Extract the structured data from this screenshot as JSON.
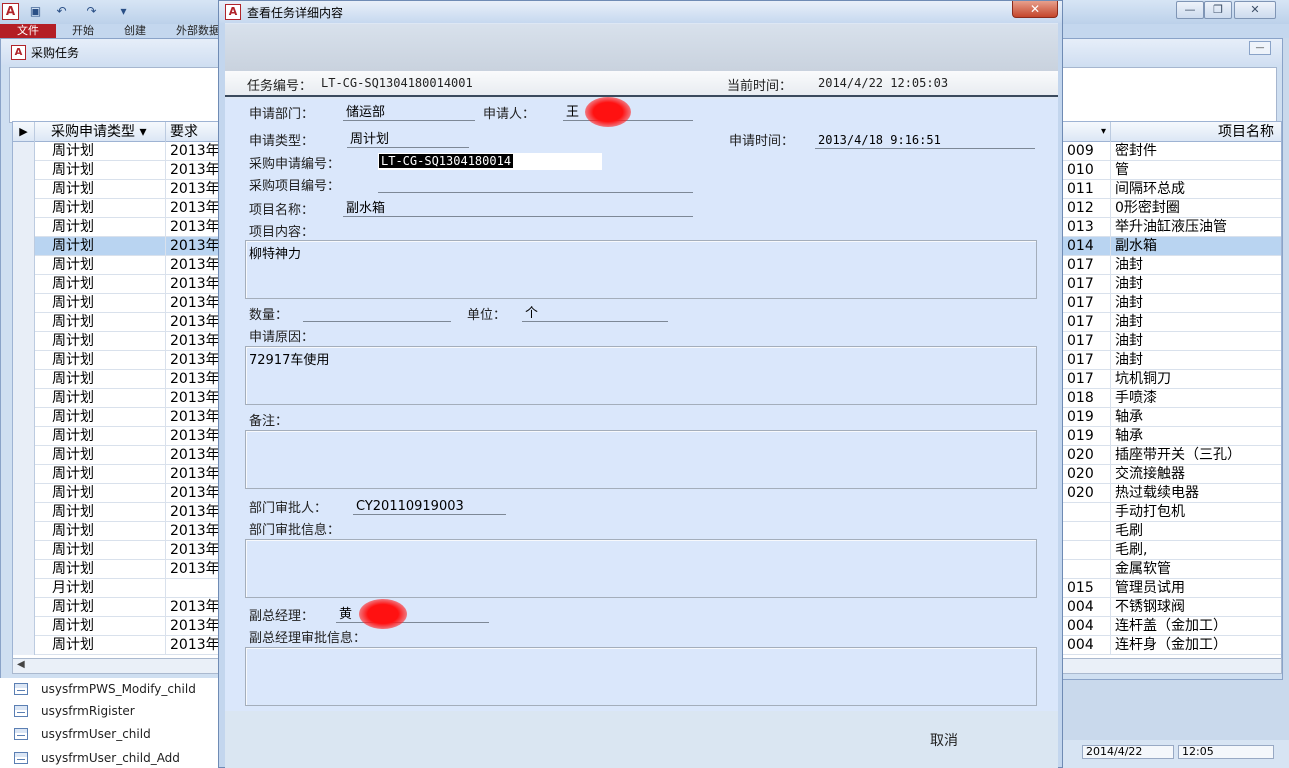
{
  "app": {
    "icon_letter": "A",
    "ribbon_tabs": [
      "文件",
      "开始",
      "创建",
      "外部数据"
    ],
    "quick_access": [
      "save-icon",
      "undo-icon",
      "redo-icon",
      "customize-icon"
    ],
    "window_controls": [
      "minimize",
      "restore",
      "close"
    ]
  },
  "inner_window": {
    "title": "采购任务",
    "columns": [
      "采购申请类型",
      "要求",
      "项目名称"
    ],
    "rows": [
      {
        "type": "周计划",
        "date": "2013年",
        "code": "009",
        "name": "密封件"
      },
      {
        "type": "周计划",
        "date": "2013年",
        "code": "010",
        "name": "管"
      },
      {
        "type": "周计划",
        "date": "2013年",
        "code": "011",
        "name": "间隔环总成"
      },
      {
        "type": "周计划",
        "date": "2013年",
        "code": "012",
        "name": "0形密封圈"
      },
      {
        "type": "周计划",
        "date": "2013年",
        "code": "013",
        "name": "举升油缸液压油管"
      },
      {
        "type": "周计划",
        "date": "2013年",
        "code": "014",
        "name": "副水箱"
      },
      {
        "type": "周计划",
        "date": "2013年",
        "code": "017",
        "name": "油封"
      },
      {
        "type": "周计划",
        "date": "2013年",
        "code": "017",
        "name": "油封"
      },
      {
        "type": "周计划",
        "date": "2013年",
        "code": "017",
        "name": "油封"
      },
      {
        "type": "周计划",
        "date": "2013年",
        "code": "017",
        "name": "油封"
      },
      {
        "type": "周计划",
        "date": "2013年",
        "code": "017",
        "name": "油封"
      },
      {
        "type": "周计划",
        "date": "2013年",
        "code": "017",
        "name": "油封"
      },
      {
        "type": "周计划",
        "date": "2013年",
        "code": "017",
        "name": "坑机铜刀"
      },
      {
        "type": "周计划",
        "date": "2013年",
        "code": "018",
        "name": "手喷漆"
      },
      {
        "type": "周计划",
        "date": "2013年",
        "code": "019",
        "name": "轴承"
      },
      {
        "type": "周计划",
        "date": "2013年",
        "code": "019",
        "name": "轴承"
      },
      {
        "type": "周计划",
        "date": "2013年",
        "code": "020",
        "name": "插座带开关（三孔）"
      },
      {
        "type": "周计划",
        "date": "2013年",
        "code": "020",
        "name": "交流接触器"
      },
      {
        "type": "周计划",
        "date": "2013年",
        "code": "020",
        "name": "热过载续电器"
      },
      {
        "type": "周计划",
        "date": "2013年",
        "code": "",
        "name": "手动打包机"
      },
      {
        "type": "周计划",
        "date": "2013年",
        "code": "",
        "name": "毛刷"
      },
      {
        "type": "周计划",
        "date": "2013年",
        "code": "",
        "name": "毛刷,"
      },
      {
        "type": "周计划",
        "date": "2013年",
        "code": "",
        "name": "金属软管"
      },
      {
        "type": "月计划",
        "date": "",
        "code": "015",
        "name": "管理员试用"
      },
      {
        "type": "周计划",
        "date": "2013年",
        "code": "004",
        "name": "不锈钢球阀"
      },
      {
        "type": "周计划",
        "date": "2013年",
        "code": "004",
        "name": "连杆盖（金加工）"
      },
      {
        "type": "周计划",
        "date": "2013年",
        "code": "004",
        "name": "连杆身（金加工）"
      }
    ]
  },
  "nav": {
    "items": [
      "usysfrmPWS_Modify_child",
      "usysfrmRigister",
      "usysfrmUser_child",
      "usysfrmUser_child_Add"
    ]
  },
  "status": {
    "date": "2014/4/22",
    "time": "12:05"
  },
  "dialog": {
    "icon_letter": "A",
    "title": "查看任务详细内容",
    "close_glyph": "✕",
    "task_no_label": "任务编号：",
    "task_no": "LT-CG-SQ1304180014001",
    "current_time_label": "当前时间：",
    "current_time": "2014/4/22 12:05:03",
    "fields": {
      "dept_label": "申请部门：",
      "dept": "储运部",
      "applicant_label": "申请人：",
      "applicant": "王",
      "type_label": "申请类型：",
      "type": "周计划",
      "apply_time_label": "申请时间：",
      "apply_time": "2013/4/18 9:16:51",
      "apply_no_label": "采购申请编号：",
      "apply_no": "LT-CG-SQ1304180014",
      "project_no_label": "采购项目编号：",
      "project_no": "",
      "project_name_label": "项目名称：",
      "project_name": "副水箱",
      "content_label": "项目内容：",
      "content": "柳特神力",
      "qty_label": "数量：",
      "qty": "",
      "unit_label": "单位：",
      "unit": "个",
      "reason_label": "申请原因：",
      "reason": "72917车使用",
      "remark_label": "备注：",
      "remark": "",
      "dept_approver_label": "部门审批人：",
      "dept_approver": "CY20110919003",
      "dept_info_label": "部门审批信息：",
      "dept_info": "",
      "vgm_label": "副总经理：",
      "vgm": "黄",
      "vgm_info_label": "副总经理审批信息：",
      "vgm_info": ""
    },
    "cancel_label": "取消"
  },
  "colors": {
    "accent": "#b41e25",
    "selection": "#b9d4f1",
    "dialog_bg": "#dae7fb"
  }
}
